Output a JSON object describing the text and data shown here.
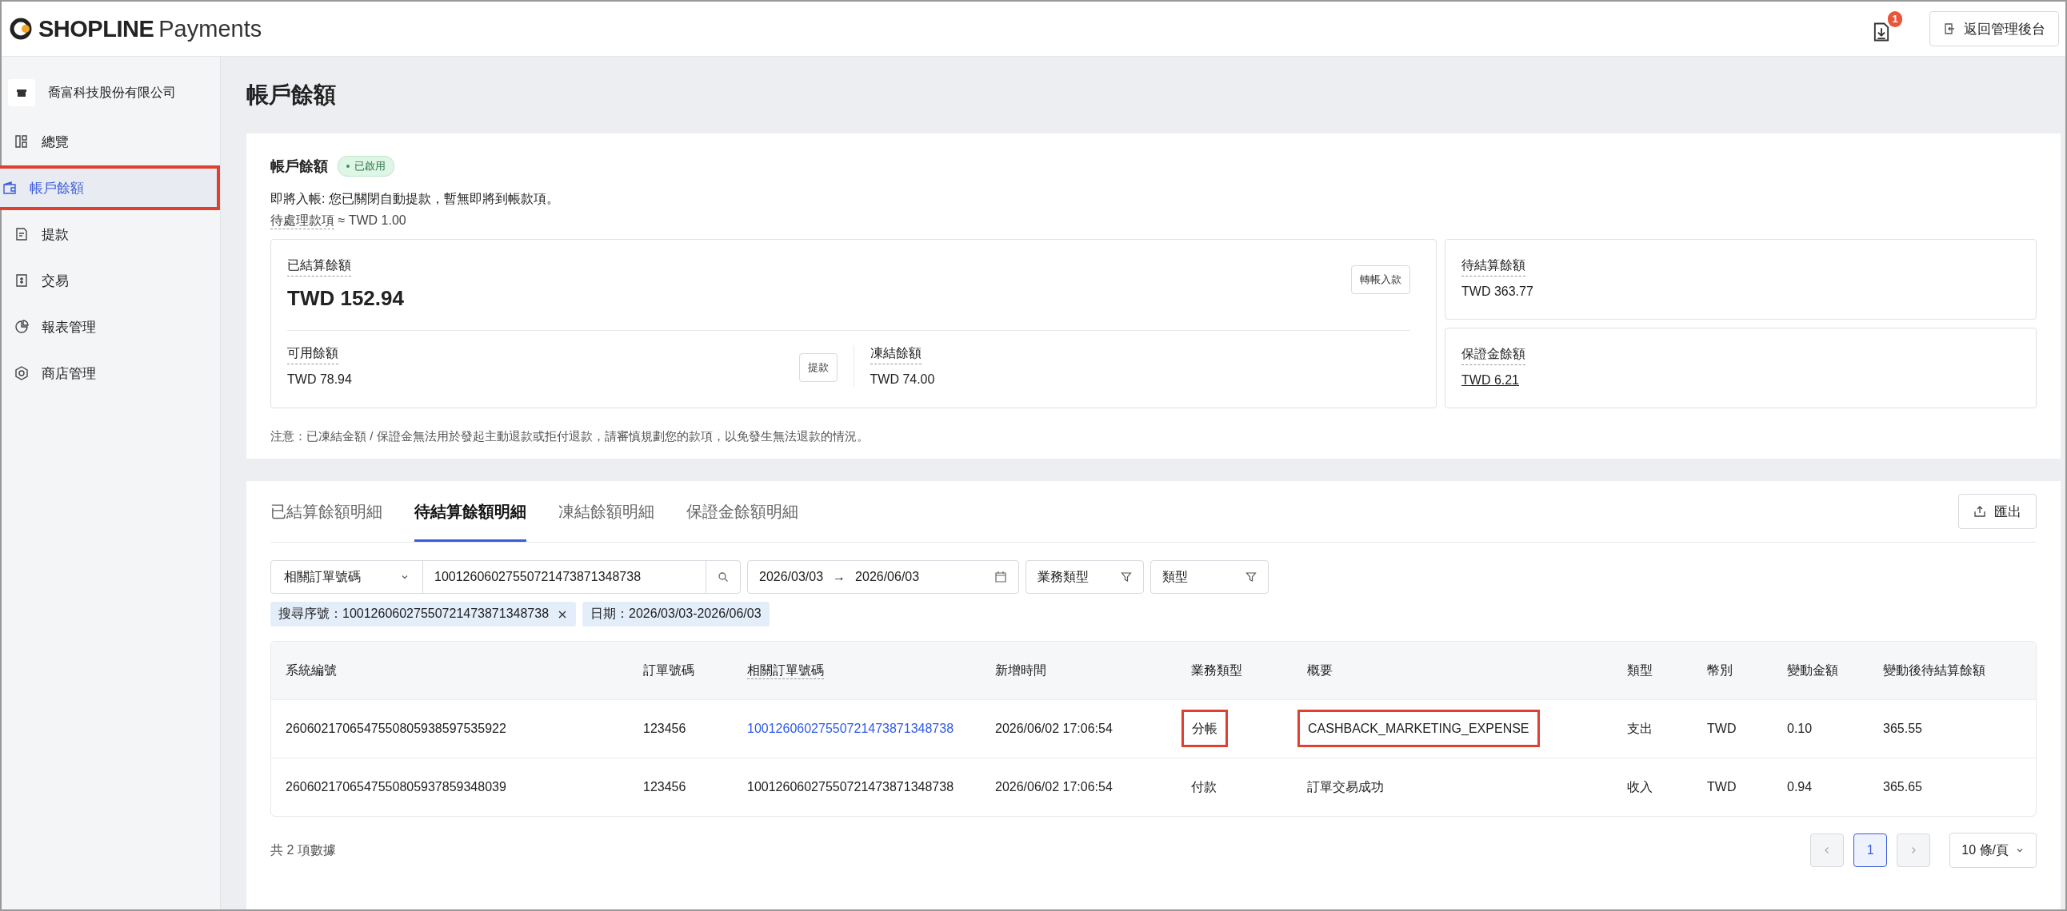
{
  "header": {
    "brand": "SHOPLINE",
    "product": "Payments",
    "download_badge": "1",
    "back_button": "返回管理後台"
  },
  "sidebar": {
    "company": "喬富科技股份有限公司",
    "items": [
      {
        "label": "總覽",
        "kind": "overview",
        "selected": false,
        "highlighted": false
      },
      {
        "label": "帳戶餘額",
        "kind": "wallet",
        "selected": true,
        "highlighted": true
      },
      {
        "label": "提款",
        "kind": "withdraw",
        "selected": false,
        "highlighted": false
      },
      {
        "label": "交易",
        "kind": "transaction",
        "selected": false,
        "highlighted": false
      },
      {
        "label": "報表管理",
        "kind": "report",
        "selected": false,
        "highlighted": false
      },
      {
        "label": "商店管理",
        "kind": "store",
        "selected": false,
        "highlighted": false
      }
    ]
  },
  "page_title": "帳戶餘額",
  "balance_card": {
    "title": "帳戶餘額",
    "status": "已啟用",
    "incoming_note": "即將入帳: 您已關閉自動提款，暫無即將到帳款項。",
    "pending_label": "待處理款項",
    "pending_value": "≈ TWD 1.00",
    "settled": {
      "label": "已結算餘額",
      "amount": "TWD 152.94",
      "button": "轉帳入款"
    },
    "available": {
      "label": "可用餘額",
      "amount": "TWD 78.94",
      "button": "提款"
    },
    "frozen": {
      "label": "凍結餘額",
      "amount": "TWD 74.00"
    },
    "unsettled": {
      "label": "待結算餘額",
      "amount": "TWD 363.77"
    },
    "deposit": {
      "label": "保證金餘額",
      "amount": "TWD 6.21"
    },
    "notice": "注意：已凍結金額 / 保證金無法用於發起主動退款或拒付退款，請審慎規劃您的款項，以免發生無法退款的情況。"
  },
  "details": {
    "tabs": [
      {
        "label": "已結算餘額明細",
        "selected": false
      },
      {
        "label": "待結算餘額明細",
        "selected": true
      },
      {
        "label": "凍結餘額明細",
        "selected": false
      },
      {
        "label": "保證金餘額明細",
        "selected": false
      }
    ],
    "export_button": "匯出",
    "filters": {
      "search_type": "相關訂單號碼",
      "search_value": "10012606027550721473871348738",
      "date_from": "2026/03/03",
      "date_separator": "→",
      "date_to": "2026/06/03",
      "business_type": "業務類型",
      "type": "類型"
    },
    "chips": [
      {
        "text": "搜尋序號：10012606027550721473871348738",
        "removable": true
      },
      {
        "text": "日期：2026/03/03-2026/06/03",
        "removable": false
      }
    ],
    "table": {
      "columns": [
        "系統編號",
        "訂單號碼",
        "相關訂單號碼",
        "新增時間",
        "業務類型",
        "概要",
        "類型",
        "幣別",
        "變動金額",
        "變動後待結算餘額"
      ],
      "rows": [
        {
          "cells": [
            {
              "text": "2606021706547550805938597535922",
              "link": false,
              "highlighted": false
            },
            {
              "text": "123456",
              "link": false,
              "highlighted": false
            },
            {
              "text": "10012606027550721473871348738",
              "link": true,
              "highlighted": false
            },
            {
              "text": "2026/06/02 17:06:54",
              "link": false,
              "highlighted": false
            },
            {
              "text": "分帳",
              "link": false,
              "highlighted": true
            },
            {
              "text": "CASHBACK_MARKETING_EXPENSE",
              "link": false,
              "highlighted": true
            },
            {
              "text": "支出",
              "link": false,
              "highlighted": false
            },
            {
              "text": "TWD",
              "link": false,
              "highlighted": false
            },
            {
              "text": "0.10",
              "link": false,
              "highlighted": false
            },
            {
              "text": "365.55",
              "link": false,
              "highlighted": false
            }
          ]
        },
        {
          "cells": [
            {
              "text": "2606021706547550805937859348039",
              "link": false,
              "highlighted": false
            },
            {
              "text": "123456",
              "link": false,
              "highlighted": false
            },
            {
              "text": "10012606027550721473871348738",
              "link": false,
              "highlighted": false
            },
            {
              "text": "2026/06/02 17:06:54",
              "link": false,
              "highlighted": false
            },
            {
              "text": "付款",
              "link": false,
              "highlighted": false
            },
            {
              "text": "訂單交易成功",
              "link": false,
              "highlighted": false
            },
            {
              "text": "收入",
              "link": false,
              "highlighted": false
            },
            {
              "text": "TWD",
              "link": false,
              "highlighted": false
            },
            {
              "text": "0.94",
              "link": false,
              "highlighted": false
            },
            {
              "text": "365.65",
              "link": false,
              "highlighted": false
            }
          ]
        }
      ]
    },
    "total": "共 2 項數據",
    "pagination": {
      "pages": [
        {
          "label": "1",
          "selected": true
        }
      ],
      "page_size": "10 條/頁"
    }
  }
}
